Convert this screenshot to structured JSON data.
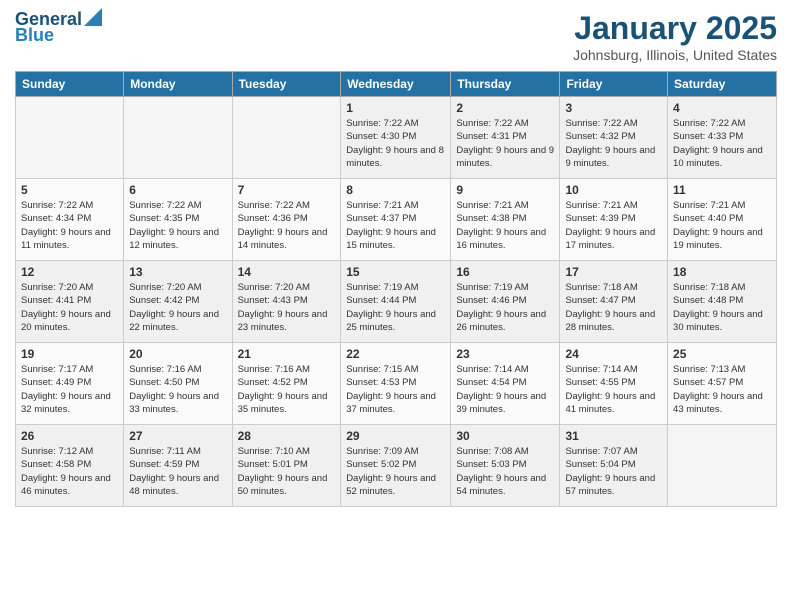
{
  "logo": {
    "line1": "General",
    "line2": "Blue"
  },
  "title": "January 2025",
  "subtitle": "Johnsburg, Illinois, United States",
  "headers": [
    "Sunday",
    "Monday",
    "Tuesday",
    "Wednesday",
    "Thursday",
    "Friday",
    "Saturday"
  ],
  "weeks": [
    [
      {
        "day": "",
        "empty": true
      },
      {
        "day": "",
        "empty": true
      },
      {
        "day": "",
        "empty": true
      },
      {
        "day": "1",
        "sunrise": "7:22 AM",
        "sunset": "4:30 PM",
        "daylight": "9 hours and 8 minutes."
      },
      {
        "day": "2",
        "sunrise": "7:22 AM",
        "sunset": "4:31 PM",
        "daylight": "9 hours and 9 minutes."
      },
      {
        "day": "3",
        "sunrise": "7:22 AM",
        "sunset": "4:32 PM",
        "daylight": "9 hours and 9 minutes."
      },
      {
        "day": "4",
        "sunrise": "7:22 AM",
        "sunset": "4:33 PM",
        "daylight": "9 hours and 10 minutes."
      }
    ],
    [
      {
        "day": "5",
        "sunrise": "7:22 AM",
        "sunset": "4:34 PM",
        "daylight": "9 hours and 11 minutes."
      },
      {
        "day": "6",
        "sunrise": "7:22 AM",
        "sunset": "4:35 PM",
        "daylight": "9 hours and 12 minutes."
      },
      {
        "day": "7",
        "sunrise": "7:22 AM",
        "sunset": "4:36 PM",
        "daylight": "9 hours and 14 minutes."
      },
      {
        "day": "8",
        "sunrise": "7:21 AM",
        "sunset": "4:37 PM",
        "daylight": "9 hours and 15 minutes."
      },
      {
        "day": "9",
        "sunrise": "7:21 AM",
        "sunset": "4:38 PM",
        "daylight": "9 hours and 16 minutes."
      },
      {
        "day": "10",
        "sunrise": "7:21 AM",
        "sunset": "4:39 PM",
        "daylight": "9 hours and 17 minutes."
      },
      {
        "day": "11",
        "sunrise": "7:21 AM",
        "sunset": "4:40 PM",
        "daylight": "9 hours and 19 minutes."
      }
    ],
    [
      {
        "day": "12",
        "sunrise": "7:20 AM",
        "sunset": "4:41 PM",
        "daylight": "9 hours and 20 minutes."
      },
      {
        "day": "13",
        "sunrise": "7:20 AM",
        "sunset": "4:42 PM",
        "daylight": "9 hours and 22 minutes."
      },
      {
        "day": "14",
        "sunrise": "7:20 AM",
        "sunset": "4:43 PM",
        "daylight": "9 hours and 23 minutes."
      },
      {
        "day": "15",
        "sunrise": "7:19 AM",
        "sunset": "4:44 PM",
        "daylight": "9 hours and 25 minutes."
      },
      {
        "day": "16",
        "sunrise": "7:19 AM",
        "sunset": "4:46 PM",
        "daylight": "9 hours and 26 minutes."
      },
      {
        "day": "17",
        "sunrise": "7:18 AM",
        "sunset": "4:47 PM",
        "daylight": "9 hours and 28 minutes."
      },
      {
        "day": "18",
        "sunrise": "7:18 AM",
        "sunset": "4:48 PM",
        "daylight": "9 hours and 30 minutes."
      }
    ],
    [
      {
        "day": "19",
        "sunrise": "7:17 AM",
        "sunset": "4:49 PM",
        "daylight": "9 hours and 32 minutes."
      },
      {
        "day": "20",
        "sunrise": "7:16 AM",
        "sunset": "4:50 PM",
        "daylight": "9 hours and 33 minutes."
      },
      {
        "day": "21",
        "sunrise": "7:16 AM",
        "sunset": "4:52 PM",
        "daylight": "9 hours and 35 minutes."
      },
      {
        "day": "22",
        "sunrise": "7:15 AM",
        "sunset": "4:53 PM",
        "daylight": "9 hours and 37 minutes."
      },
      {
        "day": "23",
        "sunrise": "7:14 AM",
        "sunset": "4:54 PM",
        "daylight": "9 hours and 39 minutes."
      },
      {
        "day": "24",
        "sunrise": "7:14 AM",
        "sunset": "4:55 PM",
        "daylight": "9 hours and 41 minutes."
      },
      {
        "day": "25",
        "sunrise": "7:13 AM",
        "sunset": "4:57 PM",
        "daylight": "9 hours and 43 minutes."
      }
    ],
    [
      {
        "day": "26",
        "sunrise": "7:12 AM",
        "sunset": "4:58 PM",
        "daylight": "9 hours and 46 minutes."
      },
      {
        "day": "27",
        "sunrise": "7:11 AM",
        "sunset": "4:59 PM",
        "daylight": "9 hours and 48 minutes."
      },
      {
        "day": "28",
        "sunrise": "7:10 AM",
        "sunset": "5:01 PM",
        "daylight": "9 hours and 50 minutes."
      },
      {
        "day": "29",
        "sunrise": "7:09 AM",
        "sunset": "5:02 PM",
        "daylight": "9 hours and 52 minutes."
      },
      {
        "day": "30",
        "sunrise": "7:08 AM",
        "sunset": "5:03 PM",
        "daylight": "9 hours and 54 minutes."
      },
      {
        "day": "31",
        "sunrise": "7:07 AM",
        "sunset": "5:04 PM",
        "daylight": "9 hours and 57 minutes."
      },
      {
        "day": "",
        "empty": true
      }
    ]
  ],
  "labels": {
    "sunrise": "Sunrise:",
    "sunset": "Sunset:",
    "daylight": "Daylight:"
  }
}
